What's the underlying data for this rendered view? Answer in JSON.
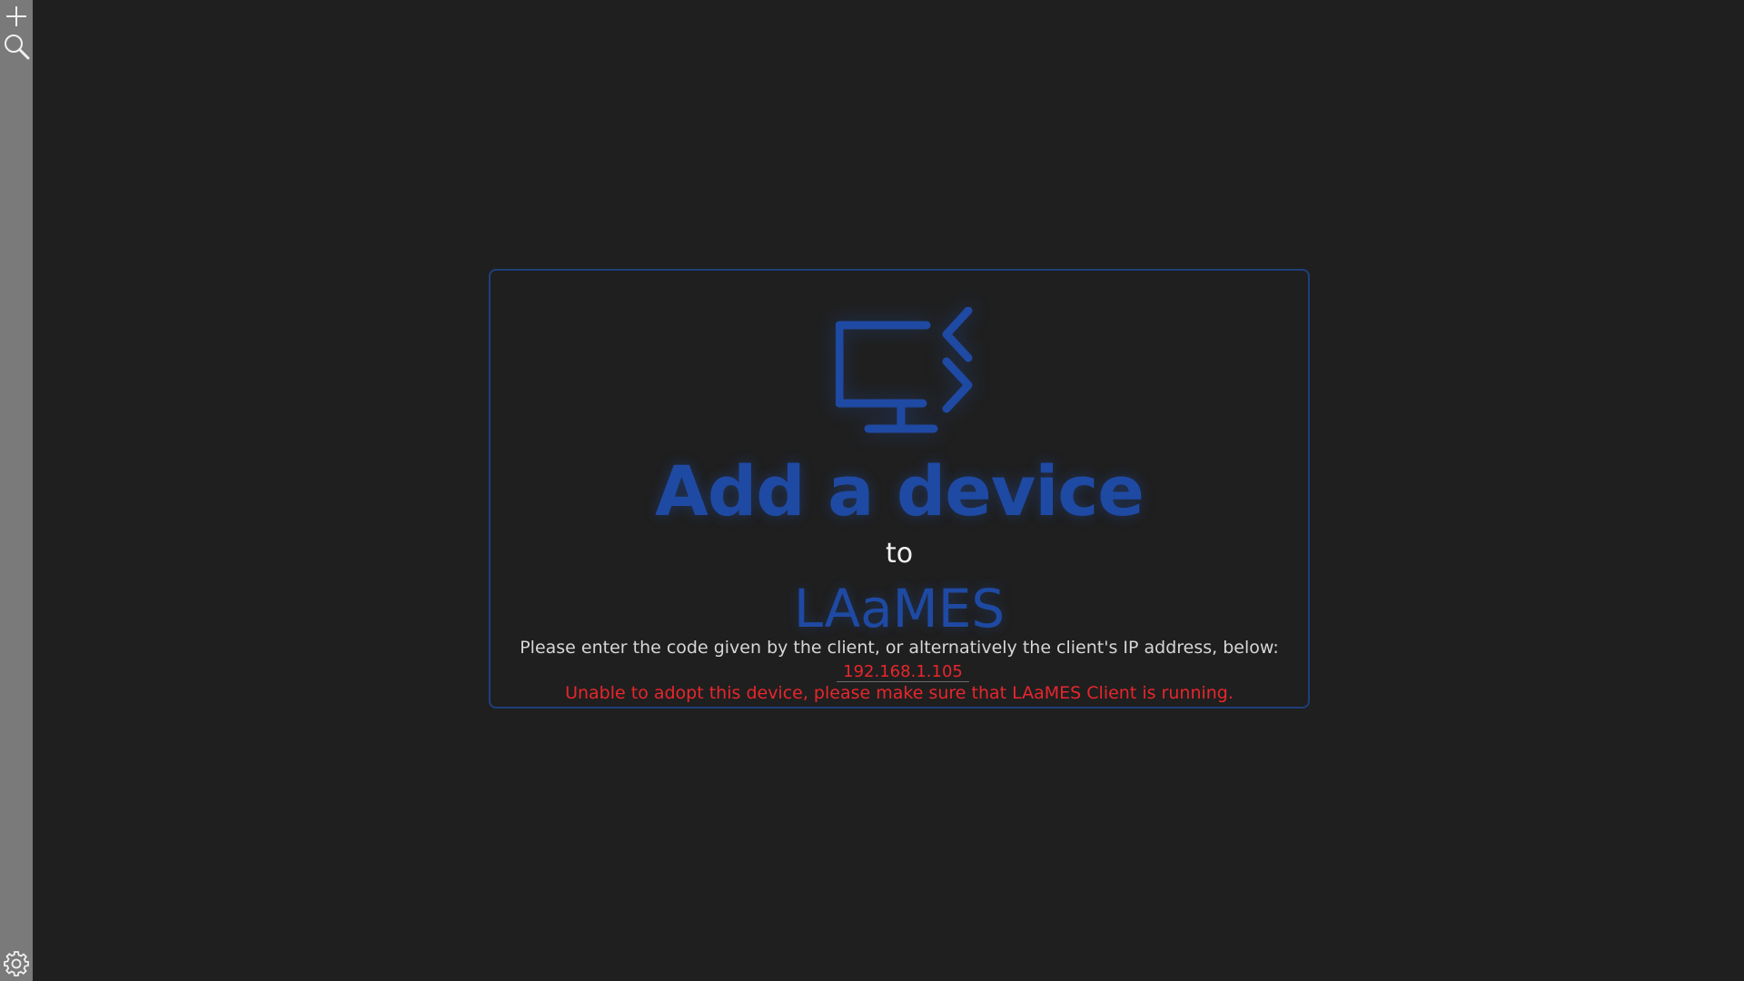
{
  "sidebar": {
    "icons": [
      "plus-icon",
      "search-icon",
      "gear-icon"
    ]
  },
  "card": {
    "title": "Add a device",
    "connector": "to",
    "brand": "LAaMES",
    "instructions": "Please enter the code given by the client, or alternatively the client's IP address, below:",
    "ip_value": "192.168.1.105",
    "error": "Unable to adopt this device, please make sure that LAaMES Client is running."
  },
  "colors": {
    "accent": "#1f4aa3",
    "error": "#e8262c",
    "background": "#1f1f1f",
    "sidebar": "#7a7a7a"
  }
}
